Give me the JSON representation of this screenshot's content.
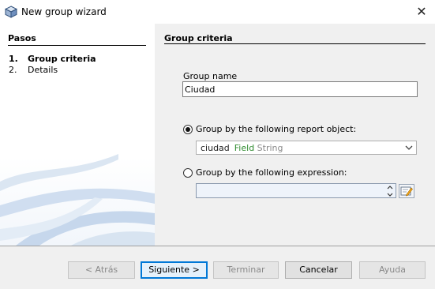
{
  "window": {
    "title": "New group wizard",
    "close_glyph": "✕"
  },
  "steps": {
    "header": "Pasos",
    "items": [
      {
        "num": "1.",
        "label": "Group criteria",
        "active": true
      },
      {
        "num": "2.",
        "label": "Details",
        "active": false
      }
    ]
  },
  "main": {
    "section_title": "Group criteria",
    "group_name_label": "Group name",
    "group_name_value": "Ciudad",
    "option_report_object": {
      "label": "Group by the following report object:",
      "selected": true
    },
    "report_object": {
      "name": "ciudad",
      "kind": "Field",
      "type": "String"
    },
    "option_expression": {
      "label": "Group by the following expression:",
      "selected": false
    },
    "expression_value": ""
  },
  "buttons": {
    "back": "< Atrás",
    "next": "Siguiente >",
    "finish": "Terminar",
    "cancel": "Cancelar",
    "help": "Ayuda"
  },
  "colors": {
    "field_kind": "#2e8b2e",
    "default_button_border": "#0078d7"
  }
}
